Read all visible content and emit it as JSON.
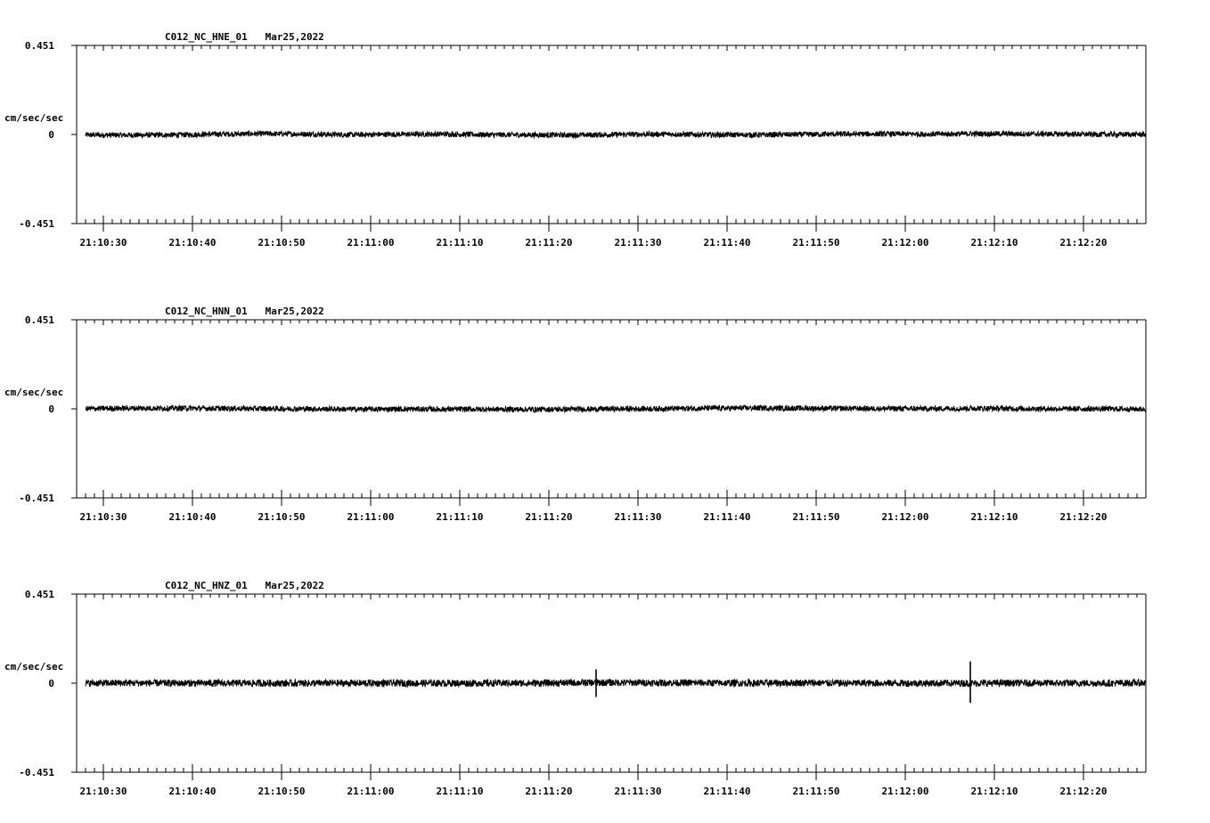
{
  "chart_data": [
    {
      "type": "line",
      "title": "C012_NC_HNE_01   Mar25,2022",
      "ylabel": "cm/sec/sec",
      "ylim": [
        -0.451,
        0.451
      ],
      "yticks": [
        "0.451",
        "0",
        "-0.451"
      ],
      "xlim": [
        "21:10:27",
        "21:12:27"
      ],
      "xticks": [
        "21:10:30",
        "21:10:40",
        "21:10:50",
        "21:11:00",
        "21:11:10",
        "21:11:20",
        "21:11:30",
        "21:11:40",
        "21:11:50",
        "21:12:00",
        "21:12:10",
        "21:12:20"
      ],
      "series": [
        {
          "x": [
            "21:10:28",
            "21:10:33",
            "21:10:38",
            "21:10:43",
            "21:10:48",
            "21:10:53",
            "21:10:58",
            "21:11:03",
            "21:11:08",
            "21:11:13",
            "21:11:18",
            "21:11:23",
            "21:11:28",
            "21:11:33",
            "21:11:38",
            "21:11:43",
            "21:11:48",
            "21:11:53",
            "21:11:58",
            "21:12:03",
            "21:12:08",
            "21:12:13",
            "21:12:18",
            "21:12:23",
            "21:12:27"
          ],
          "values": [
            -0.002,
            -0.003,
            -0.002,
            0.002,
            0.004,
            0.002,
            -0.001,
            0.001,
            0.002,
            -0.001,
            -0.002,
            -0.003,
            0.0,
            0.002,
            -0.001,
            -0.002,
            0.0,
            0.002,
            0.003,
            0.002,
            0.004,
            0.003,
            0.002,
            0.0,
            0.001
          ],
          "noise_amplitude": 0.014
        }
      ]
    },
    {
      "type": "line",
      "title": "C012_NC_HNN_01   Mar25,2022",
      "ylabel": "cm/sec/sec",
      "ylim": [
        -0.451,
        0.451
      ],
      "yticks": [
        "0.451",
        "0",
        "-0.451"
      ],
      "xlim": [
        "21:10:27",
        "21:12:27"
      ],
      "xticks": [
        "21:10:30",
        "21:10:40",
        "21:10:50",
        "21:11:00",
        "21:11:10",
        "21:11:20",
        "21:11:30",
        "21:11:40",
        "21:11:50",
        "21:12:00",
        "21:12:10",
        "21:12:20"
      ],
      "series": [
        {
          "x": [
            "21:10:28",
            "21:10:33",
            "21:10:38",
            "21:10:43",
            "21:10:48",
            "21:10:53",
            "21:10:58",
            "21:11:03",
            "21:11:08",
            "21:11:13",
            "21:11:18",
            "21:11:23",
            "21:11:28",
            "21:11:33",
            "21:11:38",
            "21:11:43",
            "21:11:48",
            "21:11:53",
            "21:11:58",
            "21:12:03",
            "21:12:08",
            "21:12:13",
            "21:12:18",
            "21:12:23",
            "21:12:27"
          ],
          "values": [
            0.001,
            0.003,
            0.003,
            0.002,
            0.001,
            0.0,
            -0.002,
            -0.001,
            -0.002,
            -0.002,
            -0.003,
            -0.002,
            0.0,
            0.001,
            0.003,
            0.004,
            0.003,
            0.002,
            0.001,
            0.001,
            0.003,
            0.001,
            0.0,
            0.0,
            -0.002
          ],
          "noise_amplitude": 0.014
        }
      ]
    },
    {
      "type": "line",
      "title": "C012_NC_HNZ_01   Mar25,2022",
      "ylabel": "cm/sec/sec",
      "ylim": [
        -0.451,
        0.451
      ],
      "yticks": [
        "0.451",
        "0",
        "-0.451"
      ],
      "xlim": [
        "21:10:27",
        "21:12:27"
      ],
      "xticks": [
        "21:10:30",
        "21:10:40",
        "21:10:50",
        "21:11:00",
        "21:11:10",
        "21:11:20",
        "21:11:30",
        "21:11:40",
        "21:11:50",
        "21:12:00",
        "21:12:10",
        "21:12:20"
      ],
      "series": [
        {
          "x": [
            "21:10:28",
            "21:10:33",
            "21:10:38",
            "21:10:43",
            "21:10:48",
            "21:10:53",
            "21:10:58",
            "21:11:03",
            "21:11:08",
            "21:11:13",
            "21:11:18",
            "21:11:23",
            "21:11:28",
            "21:11:33",
            "21:11:38",
            "21:11:43",
            "21:11:48",
            "21:11:53",
            "21:11:58",
            "21:12:03",
            "21:12:08",
            "21:12:13",
            "21:12:18",
            "21:12:23",
            "21:12:27"
          ],
          "values": [
            0.0,
            0.001,
            0.0,
            0.0,
            0.0,
            0.0,
            0.0,
            0.0,
            0.0,
            0.0,
            0.0,
            0.002,
            0.003,
            0.002,
            0.001,
            0.0,
            0.002,
            0.0,
            0.0,
            0.0,
            0.0,
            0.001,
            0.0,
            0.0,
            0.002
          ],
          "noise_amplitude": 0.018,
          "spikes": [
            {
              "x": "21:11:25.3",
              "max": 0.07,
              "min": -0.07
            },
            {
              "x": "21:12:07.3",
              "max": 0.11,
              "min": -0.1
            }
          ]
        }
      ]
    }
  ]
}
